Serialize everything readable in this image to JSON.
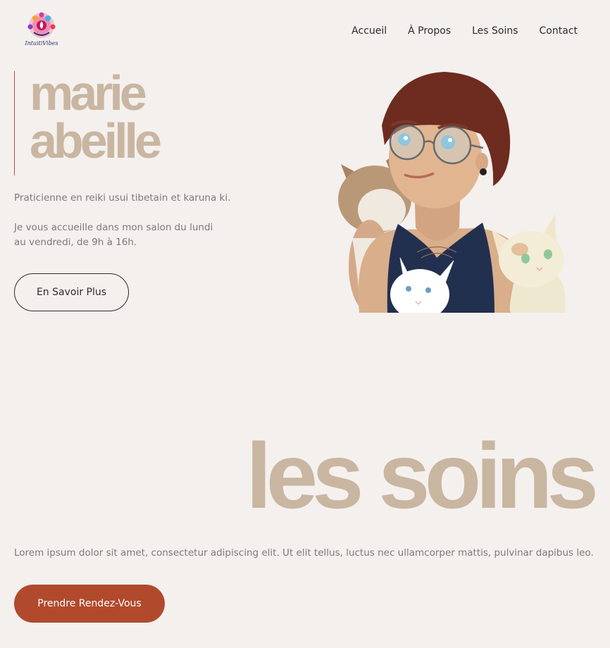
{
  "brand": {
    "logo_text": "IntuitiVibes"
  },
  "nav": {
    "items": [
      {
        "label": "Accueil"
      },
      {
        "label": "À Propos"
      },
      {
        "label": "Les Soins"
      },
      {
        "label": "Contact"
      }
    ]
  },
  "hero": {
    "title_line1": "marie",
    "title_line2": "abeille",
    "paragraph1": "Praticienne en reiki usui tibetain et karuna ki.",
    "paragraph2": "Je vous accueille dans mon salon du lundi au vendredi, de 9h à 16h.",
    "button_label": "En Savoir Plus"
  },
  "soins": {
    "title": "les soins",
    "text": "Lorem ipsum dolor sit amet, consectetur adipiscing elit. Ut elit tellus, luctus nec ullamcorper mattis, pulvinar dapibus leo.",
    "button_label": "Prendre Rendez-Vous"
  },
  "colors": {
    "background": "#f4f0ed",
    "title_beige": "#c9b6a1",
    "accent_rust": "#b14a2d",
    "text_gray": "#7b7b7b",
    "nav_text": "#2c2c2c"
  }
}
